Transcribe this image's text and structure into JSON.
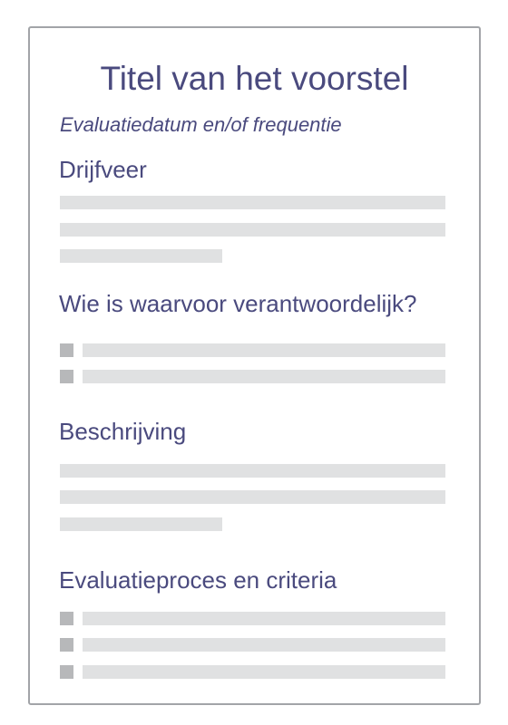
{
  "document": {
    "title": "Titel van het voorstel",
    "subtitle": "Evaluatiedatum en/of frequentie",
    "sections": [
      {
        "heading": "Drijfveer",
        "content": "paragraph-placeholder"
      },
      {
        "heading": "Wie is waarvoor verantwoordelijk?",
        "content": "bullet-list-placeholder"
      },
      {
        "heading": "Beschrijving",
        "content": "paragraph-placeholder"
      },
      {
        "heading": "Evaluatieproces en criteria",
        "content": "bullet-list-placeholder"
      }
    ]
  },
  "colors": {
    "text": "#4a4a7e",
    "border": "#a2a4a8",
    "placeholder_bar": "#e0e1e2",
    "placeholder_bullet": "#b7b8ba"
  }
}
